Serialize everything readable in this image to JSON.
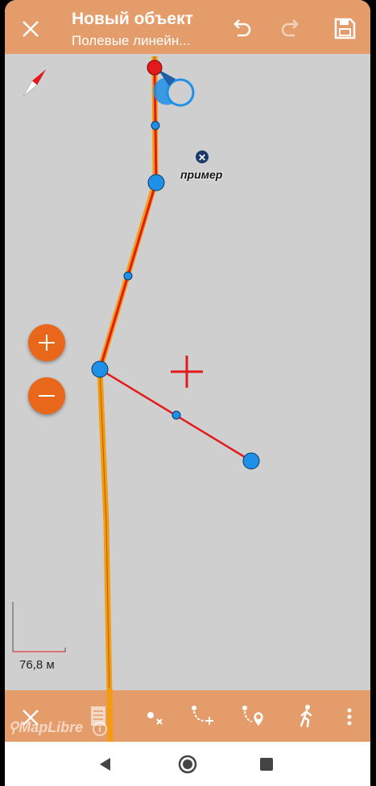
{
  "header": {
    "title": "Новый объект",
    "subtitle": "Полевые линейн...",
    "close_icon": "close-icon",
    "undo_icon": "undo-icon",
    "redo_icon": "redo-icon",
    "save_icon": "save-icon"
  },
  "map": {
    "poi_label": "пример",
    "scale_label": "76,8 м",
    "attribution": "MapLibre",
    "zoom_in_icon": "plus-icon",
    "zoom_out_icon": "minus-icon",
    "line_color": "#e31a1c",
    "existing_line_color": "#f39c12",
    "vertex_color": "#1e90e8"
  },
  "toolbar": {
    "icons": [
      "close-icon",
      "document-icon",
      "delete-vertex-icon",
      "add-vertex-icon",
      "add-point-icon",
      "walk-icon",
      "more-icon"
    ]
  },
  "navbar": {
    "icons": [
      "back-icon",
      "home-icon",
      "recents-icon"
    ]
  },
  "colors": {
    "accent": "#e59c6b",
    "zoom_button": "#e8671a",
    "map_background": "#cfcfcf"
  }
}
